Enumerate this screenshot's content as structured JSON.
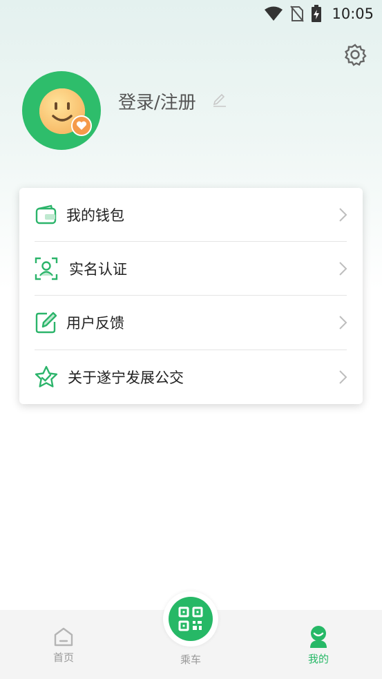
{
  "status_bar": {
    "time": "10:05"
  },
  "profile": {
    "login_label": "登录/注册"
  },
  "menu": {
    "items": [
      {
        "label": "我的钱包",
        "icon": "wallet-icon"
      },
      {
        "label": "实名认证",
        "icon": "id-verify-icon"
      },
      {
        "label": "用户反馈",
        "icon": "feedback-icon"
      },
      {
        "label": "关于遂宁发展公交",
        "icon": "star-badge-icon"
      }
    ]
  },
  "bottom_nav": {
    "home": {
      "label": "首页",
      "icon": "home-icon"
    },
    "ride": {
      "label": "乘车",
      "icon": "qr-code-icon"
    },
    "mine": {
      "label": "我的",
      "icon": "user-icon"
    }
  },
  "colors": {
    "accent": "#26b866",
    "avatar_bg": "#2ebd6b",
    "badge": "#f59a4a",
    "inactive": "#999999"
  }
}
